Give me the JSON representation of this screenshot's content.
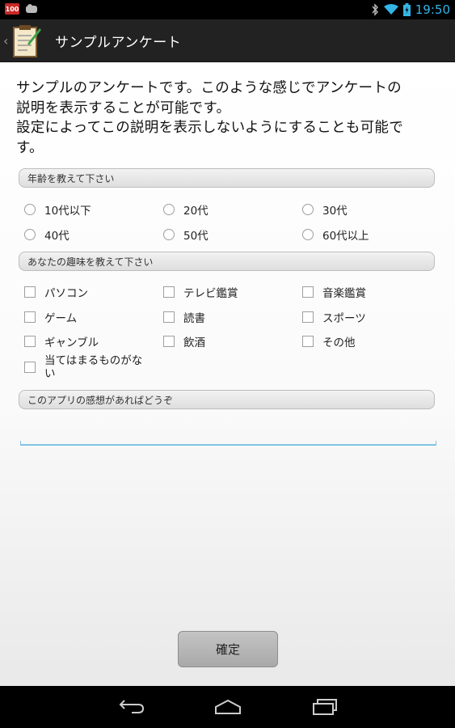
{
  "status_bar": {
    "badge_text": "100",
    "time": "19:50",
    "icons": [
      "bluetooth-icon",
      "wifi-icon",
      "battery-icon"
    ]
  },
  "action_bar": {
    "title": "サンプルアンケート"
  },
  "description": {
    "line1": "サンプルのアンケートです。このような感じでアンケートの",
    "line2": "説明を表示することが可能です。",
    "line3": "設定によってこの説明を表示しないようにすることも可能で",
    "line4": "す。"
  },
  "questions": {
    "age": {
      "label": "年齢を教えて下さい",
      "options": [
        "10代以下",
        "20代",
        "30代",
        "40代",
        "50代",
        "60代以上"
      ]
    },
    "hobby": {
      "label": "あなたの趣味を教えて下さい",
      "options": [
        "パソコン",
        "テレビ鑑賞",
        "音楽鑑賞",
        "ゲーム",
        "読書",
        "スポーツ",
        "ギャンブル",
        "飲酒",
        "その他"
      ],
      "none_option_line1": "当てはまるものがな",
      "none_option_line2": "い"
    },
    "impression": {
      "label": "このアプリの感想があればどうぞ",
      "value": ""
    }
  },
  "confirm_button": "確定",
  "nav_bar": {
    "icons": [
      "back-icon",
      "home-icon",
      "recent-apps-icon"
    ]
  },
  "colors": {
    "accent": "#33b5e5",
    "input_underline": "#7fc4e3",
    "actionbar_bg": "#222222"
  }
}
